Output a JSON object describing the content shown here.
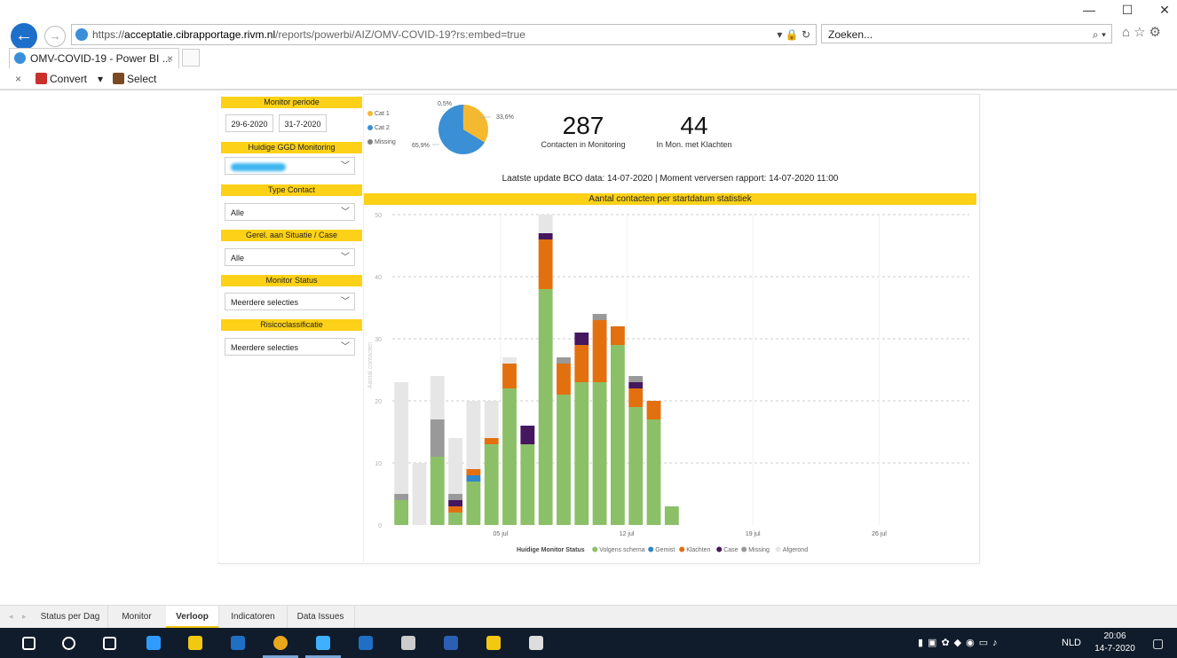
{
  "window": {
    "minimize": "—",
    "maximize": "☐",
    "close": "✕"
  },
  "address": {
    "scheme": "https://",
    "domain": "acceptatie.cibrapportage.rivm.nl",
    "path": "/reports/powerbi/AIZ/OMV-COVID-19?rs:embed=true",
    "icons": "▾ 🔒 ↻",
    "search_placeholder": "Zoeken...",
    "search_icon": "⌕ ▾"
  },
  "tab": {
    "title": "OMV-COVID-19 - Power BI ...",
    "close": "×"
  },
  "cmdbar": {
    "close": "×",
    "convert": "Convert",
    "convert_arrow": "▾",
    "select": "Select"
  },
  "slicers": {
    "period_title": "Monitor periode",
    "date_from": "29-6-2020",
    "date_to": "31-7-2020",
    "ggd_title": "Huidige GGD Monitoring",
    "type_title": "Type Contact",
    "type_value": "Alle",
    "situatie_title": "Gerel. aan Situatie / Case",
    "situatie_value": "Alle",
    "status_title": "Monitor Status",
    "status_value": "Meerdere selecties",
    "risico_title": "Risicoclassificatie",
    "risico_value": "Meerdere selecties"
  },
  "pie": {
    "legend": [
      {
        "name": "Cat 1",
        "color": "#f5b931"
      },
      {
        "name": "Cat 2",
        "color": "#3b8fd4"
      },
      {
        "name": "Missing",
        "color": "#808080"
      }
    ],
    "slices": [
      {
        "name": "Cat 1",
        "value": 33.4,
        "label": "33,6%",
        "color": "#f5b931"
      },
      {
        "name": "Cat 2",
        "value": 65.9,
        "label": "65,9%",
        "color": "#3b8fd4"
      },
      {
        "name": "Missing",
        "value": 0.5,
        "label": "0,5%",
        "color": "#808080"
      }
    ]
  },
  "kpis": [
    {
      "value": "287",
      "label": "Contacten in Monitoring"
    },
    {
      "value": "44",
      "label": "In Mon. met Klachten"
    }
  ],
  "updated_text": "Laatste update BCO data: 14-07-2020  |  Moment verversen rapport: 14-07-2020 11:00",
  "chart_title": "Aantal contacten per startdatum statistiek",
  "chart_data": {
    "type": "bar",
    "stacked": true,
    "ylabel": "Aantal contacten",
    "ylim": [
      0,
      50
    ],
    "yticks": [
      0,
      10,
      20,
      30,
      40,
      50
    ],
    "xlim": [
      "2020-06-29",
      "2020-07-31"
    ],
    "xticks": [
      {
        "date": "2020-07-05",
        "label": "05 jul"
      },
      {
        "date": "2020-07-12",
        "label": "12 jul"
      },
      {
        "date": "2020-07-19",
        "label": "19 jul"
      },
      {
        "date": "2020-07-26",
        "label": "26 jul"
      }
    ],
    "legend_title": "Huidige Monitor Status",
    "legend_position": "bottom",
    "categories": [
      "2020-06-29",
      "2020-06-30",
      "2020-07-01",
      "2020-07-02",
      "2020-07-03",
      "2020-07-04",
      "2020-07-05",
      "2020-07-06",
      "2020-07-07",
      "2020-07-08",
      "2020-07-09",
      "2020-07-10",
      "2020-07-11",
      "2020-07-12",
      "2020-07-13",
      "2020-07-14"
    ],
    "series": [
      {
        "name": "Volgens schema",
        "color": "#8cc068",
        "values": [
          4,
          0,
          11,
          2,
          7,
          13,
          22,
          13,
          38,
          21,
          23,
          23,
          29,
          19,
          17,
          3
        ]
      },
      {
        "name": "Gemist",
        "color": "#2f86c9",
        "values": [
          0,
          0,
          0,
          0,
          1,
          0,
          0,
          0,
          0,
          0,
          0,
          0,
          0,
          0,
          0,
          0
        ]
      },
      {
        "name": "Klachten",
        "color": "#e2700f",
        "values": [
          0,
          0,
          0,
          1,
          1,
          1,
          4,
          0,
          8,
          5,
          6,
          10,
          3,
          3,
          3,
          0
        ]
      },
      {
        "name": "Case",
        "color": "#44175e",
        "values": [
          0,
          0,
          0,
          1,
          0,
          0,
          0,
          3,
          1,
          0,
          2,
          0,
          0,
          1,
          0,
          0
        ]
      },
      {
        "name": "Missing",
        "color": "#999999",
        "values": [
          1,
          0,
          6,
          1,
          0,
          0,
          0,
          0,
          0,
          1,
          0,
          1,
          0,
          1,
          0,
          0
        ]
      },
      {
        "name": "Afgerond",
        "color": "#e6e6e6",
        "values": [
          18,
          10,
          7,
          9,
          11,
          6,
          1,
          0,
          3,
          0,
          0,
          0,
          0,
          0,
          0,
          0
        ]
      }
    ]
  },
  "pages": [
    "Status per Dag",
    "Monitor",
    "Verloop",
    "Indicatoren",
    "Data Issues"
  ],
  "active_page": "Verloop",
  "tray": {
    "lang": "NLD",
    "time": "20:06",
    "date": "14-7-2020"
  },
  "taskbar_icons": [
    {
      "name": "windows-start-icon",
      "color": "#ffffff"
    },
    {
      "name": "search-icon",
      "color": "#ffffff"
    },
    {
      "name": "task-view-icon",
      "color": "#ffffff"
    },
    {
      "name": "edge-icon",
      "color": "#2f9bff"
    },
    {
      "name": "lock-icon",
      "color": "#f2c811"
    },
    {
      "name": "outlook-icon",
      "color": "#1f6fc4"
    },
    {
      "name": "chrome-icon",
      "color": "#e9a81c"
    },
    {
      "name": "ie-icon",
      "color": "#3fb0ff"
    },
    {
      "name": "outlook2-icon",
      "color": "#1f6fc4"
    },
    {
      "name": "paint-icon",
      "color": "#cccccc"
    },
    {
      "name": "word-icon",
      "color": "#2b5fb3"
    },
    {
      "name": "explorer-icon",
      "color": "#f2c811"
    },
    {
      "name": "photos-icon",
      "color": "#dddddd"
    }
  ]
}
